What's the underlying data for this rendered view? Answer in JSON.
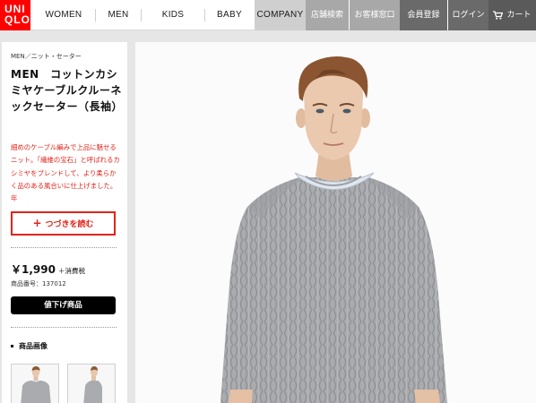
{
  "header": {
    "logo_top": "UNI",
    "logo_bottom": "QLO",
    "nav": [
      "WOMEN",
      "MEN",
      "KIDS",
      "BABY",
      "COMPANY"
    ],
    "utility": {
      "store_search": "店舗検索",
      "support": "お客様窓口",
      "register": "会員登録",
      "login": "ログイン",
      "cart": "カート"
    },
    "icons": {
      "cart": "cart-icon"
    }
  },
  "product": {
    "breadcrumb": "MEN／ニット・セーター",
    "title": "MEN　コットンカシミヤケーブルクルーネックセーター（長袖）",
    "description": "細めのケーブル編みで上品に魅せるニット。「繊維の宝石」と呼ばれるカシミヤをブレンドして、より柔らかく品のある風合いに仕上げました。年",
    "more_button": "つづきを読む",
    "price": "￥1,990",
    "tax": "＋消費税",
    "product_number": "商品番号：137012",
    "sale_button": "値下げ商品",
    "images_label": "商品画像"
  },
  "colors": {
    "brand_red": "#ff0000",
    "accent_red": "#e2231a",
    "sweater_gray": "#a9abae"
  }
}
